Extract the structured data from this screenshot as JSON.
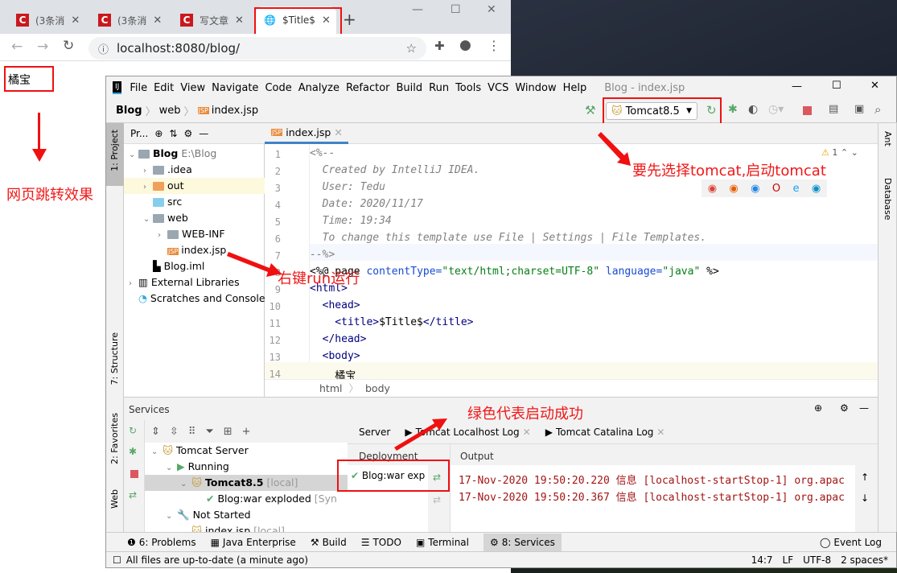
{
  "browser": {
    "tabs": [
      {
        "label": "(3条消"
      },
      {
        "label": "(3条消"
      },
      {
        "label": "写文章"
      },
      {
        "label": "$Title$",
        "active": true
      }
    ],
    "url": "localhost:8080/blog/",
    "page_text": "橘宝"
  },
  "annotations": {
    "redirect": "网页跳转效果",
    "run": "右键run运行",
    "tomcat": "要先选择tomcat,启动tomcat",
    "success": "绿色代表启动成功"
  },
  "ide": {
    "logo": "IJ",
    "menu": [
      "File",
      "Edit",
      "View",
      "Navigate",
      "Code",
      "Analyze",
      "Refactor",
      "Build",
      "Run",
      "Tools",
      "VCS",
      "Window",
      "Help"
    ],
    "title": "Blog - index.jsp",
    "breadcrumb": [
      "Blog",
      "web",
      "index.jsp"
    ],
    "run_config": "Tomcat8.5",
    "left_stripe": [
      "1: Project",
      "7: Structure",
      "2: Favorites",
      "Web"
    ],
    "right_stripe": [
      "Ant",
      "Database"
    ],
    "project": {
      "header": "Pr...",
      "items": [
        {
          "label": "Blog",
          "extra": "E:\\Blog",
          "depth": 0,
          "arrow": "v",
          "color": "#9aa7b0"
        },
        {
          "label": ".idea",
          "depth": 1,
          "arrow": ">",
          "color": "#9aa7b0"
        },
        {
          "label": "out",
          "depth": 1,
          "arrow": ">",
          "color": "#f0a05a",
          "selected": true
        },
        {
          "label": "src",
          "depth": 1,
          "arrow": "",
          "color": "#87ceeb"
        },
        {
          "label": "web",
          "depth": 1,
          "arrow": "v",
          "color": "#9aa7b0"
        },
        {
          "label": "WEB-INF",
          "depth": 2,
          "arrow": ">",
          "color": "#9aa7b0"
        },
        {
          "label": "index.jsp",
          "depth": 2,
          "arrow": "",
          "file": "jsp"
        },
        {
          "label": "Blog.iml",
          "depth": 1,
          "arrow": "",
          "file": "iml"
        },
        {
          "label": "External Libraries",
          "depth": 0,
          "arrow": ">",
          "file": "lib"
        },
        {
          "label": "Scratches and Consoles",
          "depth": 0,
          "arrow": "",
          "file": "scratch"
        }
      ]
    },
    "editor": {
      "tab": "index.jsp",
      "warning_count": "1",
      "lines": [
        "1",
        "2",
        "3",
        "4",
        "5",
        "6",
        "7",
        "8",
        "9",
        "10",
        "11",
        "12",
        "13",
        "14"
      ],
      "code": {
        "l1": "<%--",
        "l2": "  Created by IntelliJ IDEA.",
        "l3": "  User: Tedu",
        "l4": "  Date: 2020/11/17",
        "l5": "  Time: 19:34",
        "l6": "  To change this template use File | Settings | File Templates.",
        "l7": "--%>",
        "l8a": "<%@ page ",
        "l8b": "contentType=",
        "l8c": "\"text/html;charset=UTF-8\"",
        "l8d": " language=",
        "l8e": "\"java\"",
        "l8f": " %>",
        "l9": "<html>",
        "l10": "  <head>",
        "l11a": "    <title>",
        "l11b": "$Title$",
        "l11c": "</title>",
        "l12": "  </head>",
        "l13": "  <body>",
        "l14": "    橘宝"
      },
      "crumbs": [
        "html",
        "body"
      ]
    },
    "services": {
      "title": "Services",
      "tree": [
        {
          "label": "Tomcat Server",
          "depth": 0
        },
        {
          "label": "Running",
          "depth": 1
        },
        {
          "label": "Tomcat8.5",
          "extra": "[local]",
          "depth": 2,
          "selected": true
        },
        {
          "label": "Blog:war exploded",
          "extra": "[Syn",
          "depth": 3
        },
        {
          "label": "Not Started",
          "depth": 1
        },
        {
          "label": "index.jsp",
          "extra": "[local]",
          "depth": 2
        }
      ],
      "tabs": [
        "Server",
        "Tomcat Localhost Log",
        "Tomcat Catalina Log"
      ],
      "deployment_header": "Deployment",
      "deployment_item": "Blog:war exp",
      "output_header": "Output",
      "log": [
        "17-Nov-2020 19:50:20.220 信息 [localhost-startStop-1] org.apac",
        "17-Nov-2020 19:50:20.367 信息 [localhost-startStop-1] org.apac"
      ]
    },
    "toolwindows": [
      "6: Problems",
      "Java Enterprise",
      "Build",
      "TODO",
      "Terminal",
      "8: Services"
    ],
    "event_log": "Event Log",
    "status": {
      "message": "All files are up-to-date (a minute ago)",
      "position": "14:7",
      "line_sep": "LF",
      "encoding": "UTF-8",
      "indent": "2 spaces*"
    }
  },
  "colors": {
    "accent": "#4083c9",
    "red_annotation": "#f01818",
    "success": "#59a869"
  }
}
